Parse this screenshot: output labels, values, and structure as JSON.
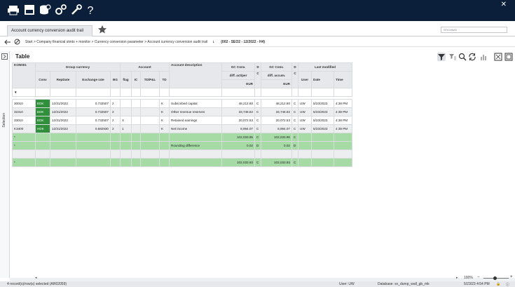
{
  "tab": {
    "label": "Account currency conversion audit trail"
  },
  "search": {
    "placeholder": "STICHWO"
  },
  "breadcrumb": {
    "path": "Start > Company financial stmts + monitor > Currency conversion parameter > Account currency conversion audit trail",
    "context": "(002 - SEO2 - 12/2022 - H4)"
  },
  "sidebar": {
    "label": "Selection"
  },
  "section": {
    "title": "Table"
  },
  "headers": {
    "kon": "KON001",
    "group_currency": "Group currency",
    "account": "Account",
    "last_modified": "Last modified",
    "conv": "Conv",
    "repdate": "RepDate",
    "exrate": "Exchange rate",
    "bg": "BG",
    "flag": "flag",
    "ic": "IC",
    "tdpl": "TD/P&L",
    "td": "TD",
    "acct_desc": "Account description",
    "gc_actper": [
      "GC Conv.",
      "diff. act/per",
      "EUR"
    ],
    "d1": [
      "D",
      "C"
    ],
    "gc_accum": [
      "GC Conv.",
      "diff. accum.",
      "EUR"
    ],
    "d2": [
      "D",
      "C"
    ],
    "user": "User",
    "date": "Date",
    "time": "Time",
    "filter": "▼"
  },
  "rows": [
    {
      "kon": "30010",
      "conv": "EDK",
      "repdate": "12/31/2022",
      "rate": "0.732507",
      "bg": "2",
      "flag": "",
      "ic": "",
      "tdpl": "",
      "td": "K",
      "desc": "Subscribed capital",
      "act": "48,212.80",
      "d1": "C",
      "acc": "48,212.80",
      "d2": "C",
      "user": "UW",
      "date": "5/23/2023",
      "time": "4:38 PM"
    },
    {
      "kon": "32310",
      "conv": "EDK",
      "repdate": "12/31/2022",
      "rate": "0.732507",
      "bg": "2",
      "flag": "",
      "ic": "",
      "tdpl": "",
      "td": "K",
      "desc": "Other revenue reserves",
      "act": "33,748.82",
      "d1": "C",
      "acc": "33,748.82",
      "d2": "C",
      "user": "UW",
      "date": "5/23/2023",
      "time": "4:38 PM"
    },
    {
      "kon": "33010",
      "conv": "EDK",
      "repdate": "12/31/2022",
      "rate": "0.732507",
      "bg": "2",
      "flag": "X",
      "ic": "",
      "tdpl": "",
      "td": "K",
      "desc": "Retained earnings",
      "act": "20,072.53",
      "d1": "C",
      "acc": "20,072.53",
      "d2": "C",
      "user": "UW",
      "date": "5/23/2023",
      "time": "4:38 PM"
    },
    {
      "kon": "K3400",
      "conv": "HDK",
      "repdate": "12/31/2022",
      "rate": "0.682930",
      "bg": "2",
      "flag": "1",
      "ic": "",
      "tdpl": "",
      "td": "K",
      "desc": "Net income",
      "act": "8,994.07",
      "d1": "C",
      "acc": "8,994.07",
      "d2": "C",
      "user": "UW",
      "date": "5/23/2023",
      "time": "4:38 PM"
    }
  ],
  "subtotal": {
    "marker": "*",
    "act": "102,033.95",
    "d1": "C",
    "acc": "102,033.95",
    "d2": "C"
  },
  "rounding": {
    "marker": "*",
    "desc": "Rounding difference",
    "act": "0.02",
    "d1": "D",
    "acc": "0.02",
    "d2": "D"
  },
  "total": {
    "marker": "*",
    "act": "102,033.93",
    "d1": "C",
    "acc": "102,033.93",
    "d2": "C"
  },
  "zoom": {
    "level": "100%"
  },
  "status": {
    "records": "4 record(s)/row(s) selected (AR02059)",
    "user": "User: UW",
    "database": "Database: sv_dump_wall_gb_mk",
    "datetime": "5/23/23  4:54 PM"
  }
}
